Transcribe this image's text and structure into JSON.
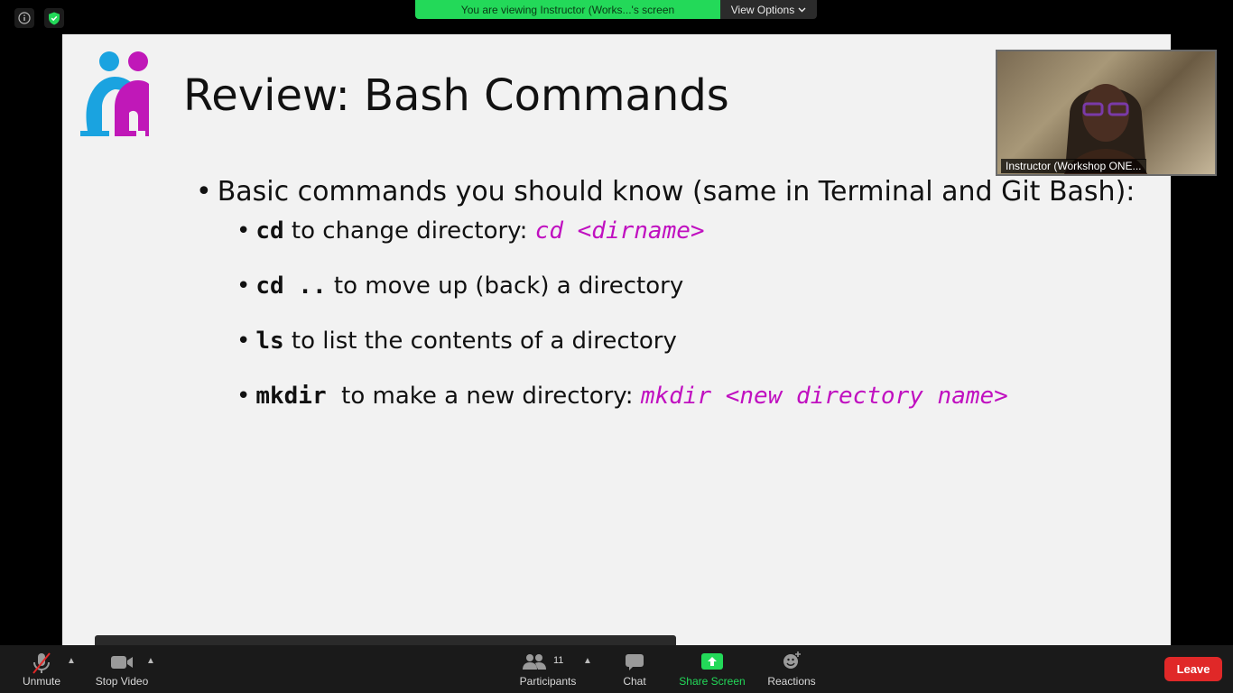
{
  "banner": {
    "text": "You are viewing Instructor (Works...'s screen",
    "view_options": "View Options"
  },
  "slide": {
    "title": "Review: Bash Commands",
    "main_bullet": "Basic commands you should know (same in Terminal and Git Bash):",
    "items": [
      {
        "cmd": "cd",
        "text": " to change directory: ",
        "example": "cd <dirname>"
      },
      {
        "cmd": "cd ..",
        "text": " to move up (back) a directory",
        "example": ""
      },
      {
        "cmd": "ls",
        "text": " to list the contents of a directory",
        "example": ""
      },
      {
        "cmd": "mkdir",
        "text": "  to make a new directory: ",
        "example": "mkdir <new directory name>"
      }
    ],
    "colors": {
      "logo_blue": "#1aa3e0",
      "logo_magenta": "#c018b8",
      "example": "#c010c0"
    }
  },
  "video": {
    "name": "Instructor (Workshop ONE..."
  },
  "toolbar": {
    "unmute": "Unmute",
    "stop_video": "Stop Video",
    "participants": "Participants",
    "participants_count": "11",
    "chat": "Chat",
    "share_screen": "Share Screen",
    "reactions": "Reactions",
    "leave": "Leave"
  },
  "icons": [
    "info-icon",
    "shield-check-icon",
    "chevron-down-icon",
    "mic-muted-icon",
    "camera-icon",
    "participants-icon",
    "chat-icon",
    "share-screen-icon",
    "reactions-icon"
  ]
}
